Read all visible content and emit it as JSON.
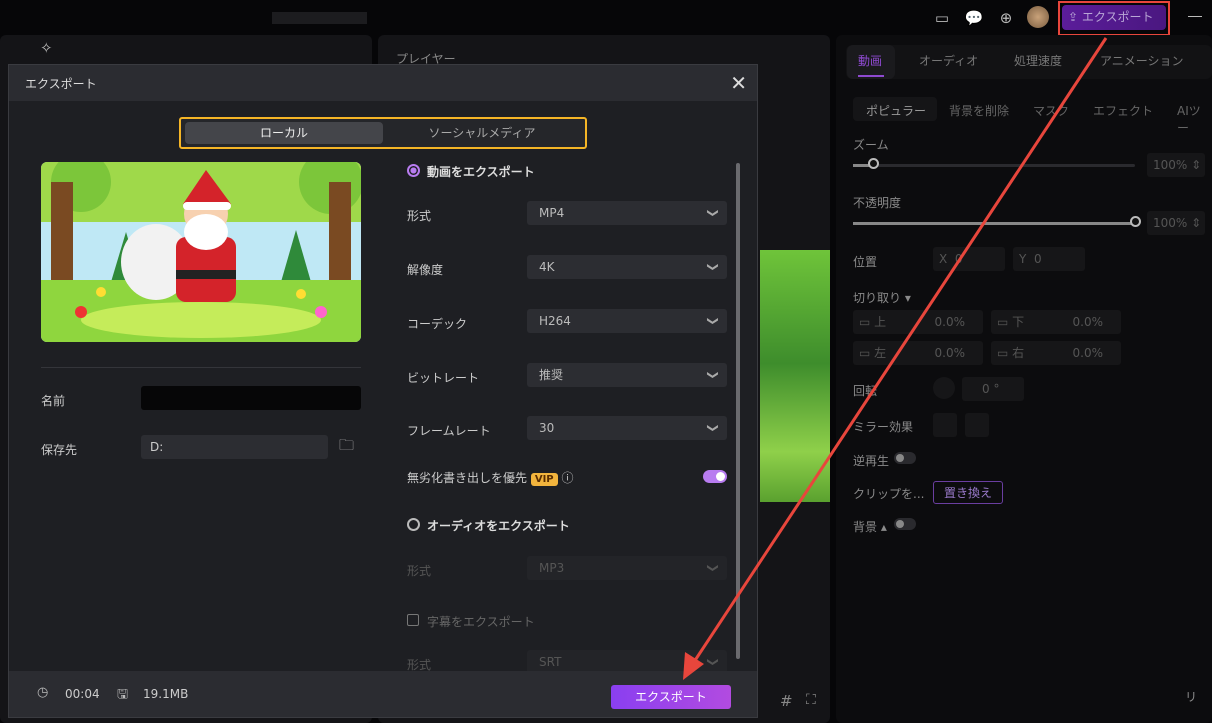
{
  "topbar": {
    "export_label": "エクスポート",
    "icons": [
      "layout-icon",
      "feedback-icon",
      "download-icon",
      "avatar",
      "minimize-icon"
    ]
  },
  "player": {
    "title": "プレイヤー"
  },
  "right_panel": {
    "tabs": [
      "動画",
      "オーディオ",
      "処理速度",
      "アニメーション"
    ],
    "subtabs": [
      "ポピュラー",
      "背景を削除",
      "マスク",
      "エフェクト",
      "AIツー"
    ],
    "zoom_label": "ズーム",
    "zoom_value": "100%",
    "zoom_fraction": 0.07,
    "opacity_label": "不透明度",
    "opacity_value": "100%",
    "opacity_fraction": 1.0,
    "position_label": "位置",
    "pos_x_label": "X",
    "pos_x": "0",
    "pos_y_label": "Y",
    "pos_y": "0",
    "crop_label": "切り取り",
    "crop": [
      {
        "label": "上",
        "value": "0.0%"
      },
      {
        "label": "下",
        "value": "0.0%"
      },
      {
        "label": "左",
        "value": "0.0%"
      },
      {
        "label": "右",
        "value": "0.0%"
      }
    ],
    "rotate_label": "回転",
    "rotate_value": "0",
    "rotate_unit": "°",
    "mirror_label": "ミラー効果",
    "reverse_label": "逆再生",
    "clip_label": "クリップを...",
    "replace_label": "置き換え",
    "background_label": "背景",
    "bottom_btn": "リ"
  },
  "dialog": {
    "title": "エクスポート",
    "tab_local": "ローカル",
    "tab_social": "ソーシャルメディア",
    "name_label": "名前",
    "save_label": "保存先",
    "save_value": "D:",
    "video_export": "動画をエクスポート",
    "fields": [
      {
        "label": "形式",
        "value": "MP4"
      },
      {
        "label": "解像度",
        "value": "4K"
      },
      {
        "label": "コーデック",
        "value": "H264"
      },
      {
        "label": "ビットレート",
        "value": "推奨"
      },
      {
        "label": "フレームレート",
        "value": "30"
      }
    ],
    "lossless_label": "無劣化書き出しを優先",
    "vip": "VIP",
    "audio_export": "オーディオをエクスポート",
    "audio_format_label": "形式",
    "audio_format": "MP3",
    "subtitle_export": "字幕をエクスポート",
    "subtitle_format_label": "形式",
    "subtitle_format": "SRT",
    "duration": "00:04",
    "size": "19.1MB",
    "export_button": "エクスポート"
  },
  "colors": {
    "accent": "#a046e8",
    "highlight_box": "#f5b526",
    "annotation": "#e8463c"
  }
}
